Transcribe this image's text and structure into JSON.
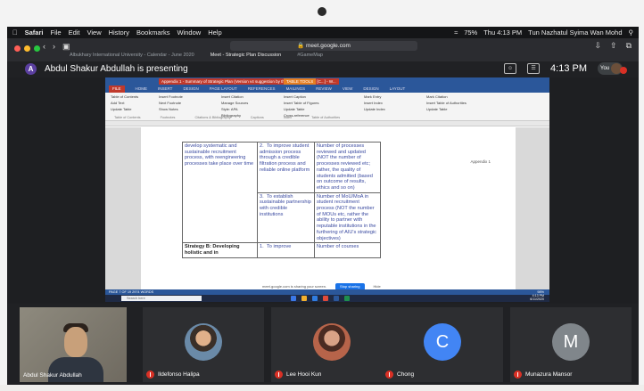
{
  "menubar": {
    "apple": "",
    "app": "Safari",
    "items": [
      "File",
      "Edit",
      "View",
      "History",
      "Bookmarks",
      "Window",
      "Help"
    ],
    "battery": "75%",
    "clock": "Thu 4:13 PM",
    "user": "Tun Nazhatul Syima Wan Mohd"
  },
  "browser": {
    "url": "meet.google.com",
    "bookmarks": [
      "Albukhary International University - Calendar - June 2020",
      "Meet - Strategic Plan Discussion",
      "#GameMap"
    ],
    "active_tab": "Meet - Strategic Plan Discussion"
  },
  "meet": {
    "presenter_initial": "A",
    "presenting_text": "Abdul Shakur Abdullah is presenting",
    "time": "4:13 PM",
    "you_label": "You"
  },
  "word": {
    "title_doc": "Appendix 1 - Summary of Strategic Plan (Version v4 suggestion by the BOG Members) [C...] - W...",
    "table_tools": "TABLE TOOLS",
    "tabs": [
      "FILE",
      "HOME",
      "INSERT",
      "DESIGN",
      "PAGE LAYOUT",
      "REFERENCES",
      "MAILINGS",
      "REVIEW",
      "VIEW",
      "DESIGN",
      "LAYOUT"
    ],
    "ribbon_items": [
      "Table of Contents",
      "Add Text",
      "Update Table",
      "Insert Footnote",
      "Next Footnote",
      "Show Notes",
      "Insert Citation",
      "Manage Sources",
      "Style: APA",
      "Bibliography",
      "Insert Caption",
      "Insert Table of Figures",
      "Update Table",
      "Cross-reference",
      "Mark Entry",
      "Insert Index",
      "Update Index",
      "Mark Citation",
      "Insert Table of Authorities",
      "Update Table"
    ],
    "ribbon_groups": [
      "Table of Contents",
      "Footnotes",
      "Citations & Bibliography",
      "Captions",
      "Index",
      "Table of Authorities"
    ],
    "appendix_label": "Appendix 1",
    "status_left": "PAGE 7 OF 19   2974 WORDS",
    "zoom": "98%",
    "share_message": "meet.google.com is sharing your screen.",
    "stop_sharing": "Stop sharing",
    "hide": "Hide",
    "search_placeholder": "Search here",
    "taskbar_time": "4:13 PM",
    "taskbar_date": "6/11/2020"
  },
  "table": {
    "row1_col1": "develop systematic and sustainable recruitment process, with reengineering processes take place over time",
    "row1_col2_num": "2.",
    "row1_col2": "To improve student admission process through a credible filtration process and reliable online platform",
    "row1_col3": "Number of processes reviewed and updated (NOT the number of processes reviewed etc; rather, the quality of students admitted (based on outcome of results, ethics and so on)",
    "row2_col2_num": "3.",
    "row2_col2": "To establish sustainable partnership with credible institutions",
    "row2_col3": "Number of MoU/MoA in student recruitment process (NOT the number of MOUs etc, rather the ability to partner with reputable institutions in the furthering of AIU's strategic objectives)",
    "row3_col1": "Strategy B: Developing holistic and in",
    "row3_col2_num": "1.",
    "row3_col2": "To improve",
    "row3_col3": "Number of courses"
  },
  "participants": [
    {
      "name": "Abdul Shakur Abdullah",
      "type": "video"
    },
    {
      "name": "Ildefonso Halipa",
      "type": "photo"
    },
    {
      "name": "Lee Hooi Kun",
      "type": "photo"
    },
    {
      "name": "Chong",
      "type": "letter",
      "letter": "C",
      "color": "#4285f4"
    },
    {
      "name": "Munazura Mansor",
      "type": "letter",
      "letter": "M",
      "color": "#80868b"
    }
  ],
  "colors": {
    "word_blue": "#2b579a",
    "meet_dark": "#202124",
    "mic_off_red": "#d93025",
    "share_blue": "#1a73e8"
  }
}
